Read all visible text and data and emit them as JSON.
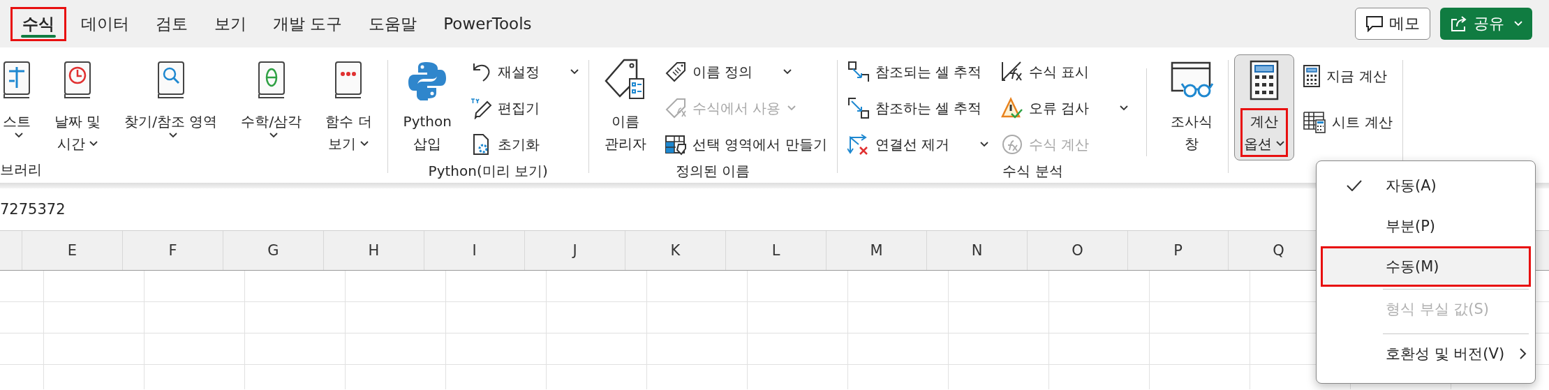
{
  "tabs": [
    {
      "label": "수식",
      "selected": true,
      "annotated": true
    },
    {
      "label": "데이터",
      "selected": false,
      "annotated": false
    },
    {
      "label": "검토",
      "selected": false,
      "annotated": false
    },
    {
      "label": "보기",
      "selected": false,
      "annotated": false
    },
    {
      "label": "개발 도구",
      "selected": false,
      "annotated": false
    },
    {
      "label": "도움말",
      "selected": false,
      "annotated": false
    },
    {
      "label": "PowerTools",
      "selected": false,
      "annotated": false
    }
  ],
  "header_buttons": [
    {
      "kind": "comment",
      "label": "메모",
      "dropdown": false
    },
    {
      "kind": "share",
      "label": "공유",
      "dropdown": true
    }
  ],
  "ribbon": {
    "groups": [
      {
        "label": "브러리",
        "columns": [
          {
            "kind": "large",
            "lines": [
              "스트"
            ],
            "dropdown": true,
            "pressed": false,
            "annotated": false
          },
          {
            "kind": "large",
            "lines": [
              "날짜 및",
              "시간"
            ],
            "dropdown": true,
            "pressed": false,
            "annotated": false
          },
          {
            "kind": "large",
            "lines": [
              "찾기/참조 영역"
            ],
            "dropdown": true,
            "pressed": false,
            "annotated": false
          },
          {
            "kind": "large",
            "lines": [
              "수학/삼각"
            ],
            "dropdown": true,
            "pressed": false,
            "annotated": false
          },
          {
            "kind": "large",
            "lines": [
              "함수 더",
              "보기"
            ],
            "dropdown": true,
            "pressed": false,
            "annotated": false
          }
        ]
      },
      {
        "label": "Python(미리 보기)",
        "columns": [
          {
            "kind": "large",
            "lines": [
              "Python",
              "삽입"
            ],
            "dropdown": false,
            "pressed": false,
            "annotated": false
          },
          {
            "kind": "stack",
            "items": [
              {
                "label": "재설정",
                "dropdown": true,
                "disabled": false
              },
              {
                "label": "편집기",
                "dropdown": false,
                "disabled": false
              },
              {
                "label": "초기화",
                "dropdown": false,
                "disabled": false
              }
            ]
          }
        ]
      },
      {
        "label": "정의된 이름",
        "columns": [
          {
            "kind": "large",
            "lines": [
              "이름",
              "관리자"
            ],
            "dropdown": false,
            "pressed": false,
            "annotated": false
          },
          {
            "kind": "stack",
            "items": [
              {
                "label": "이름 정의",
                "dropdown": true,
                "disabled": false
              },
              {
                "label": "수식에서 사용",
                "dropdown": true,
                "disabled": true
              },
              {
                "label": "선택 영역에서 만들기",
                "dropdown": false,
                "disabled": false
              }
            ]
          }
        ]
      },
      {
        "label": "수식 분석",
        "columns": [
          {
            "kind": "stack",
            "items": [
              {
                "label": "참조되는 셀 추적",
                "dropdown": false,
                "disabled": false
              },
              {
                "label": "참조하는 셀 추적",
                "dropdown": false,
                "disabled": false
              },
              {
                "label": "연결선 제거",
                "dropdown": true,
                "disabled": false
              }
            ]
          },
          {
            "kind": "stack",
            "items": [
              {
                "label": "수식 표시",
                "dropdown": false,
                "disabled": false
              },
              {
                "label": "오류 검사",
                "dropdown": true,
                "disabled": false
              },
              {
                "label": "수식 계산",
                "dropdown": false,
                "disabled": true
              }
            ]
          },
          {
            "kind": "divider"
          },
          {
            "kind": "large",
            "lines": [
              "조사식",
              "창"
            ],
            "dropdown": false,
            "pressed": false,
            "annotated": false
          }
        ]
      },
      {
        "columns": [
          {
            "kind": "large",
            "lines": [
              "계산",
              "옵션"
            ],
            "dropdown": true,
            "pressed": true,
            "annotated": true
          },
          {
            "kind": "stack",
            "items": [
              {
                "label": "지금 계산",
                "dropdown": false,
                "disabled": false
              },
              {
                "label": "시트 계산",
                "dropdown": false,
                "disabled": false
              }
            ]
          }
        ]
      }
    ]
  },
  "formula_bar": {
    "value": "7275372"
  },
  "columns": [
    "E",
    "F",
    "G",
    "H",
    "I",
    "J",
    "K",
    "L",
    "M",
    "N",
    "O",
    "P",
    "Q"
  ],
  "calc_menu": {
    "items": [
      {
        "label": "자동(A)",
        "checked": true,
        "hovered": false,
        "annotated": false,
        "disabled": false,
        "separator_before": false,
        "submenu": false
      },
      {
        "label": "부분(P)",
        "checked": false,
        "hovered": false,
        "annotated": false,
        "disabled": false,
        "separator_before": false,
        "submenu": false
      },
      {
        "label": "수동(M)",
        "checked": false,
        "hovered": true,
        "annotated": true,
        "disabled": false,
        "separator_before": false,
        "submenu": false
      },
      {
        "label": "형식 부실 값(S)",
        "checked": false,
        "hovered": false,
        "annotated": false,
        "disabled": true,
        "separator_before": true,
        "submenu": false
      },
      {
        "label": "호환성 및 버전(V)",
        "checked": false,
        "hovered": false,
        "annotated": false,
        "disabled": false,
        "separator_before": true,
        "submenu": true
      }
    ]
  }
}
